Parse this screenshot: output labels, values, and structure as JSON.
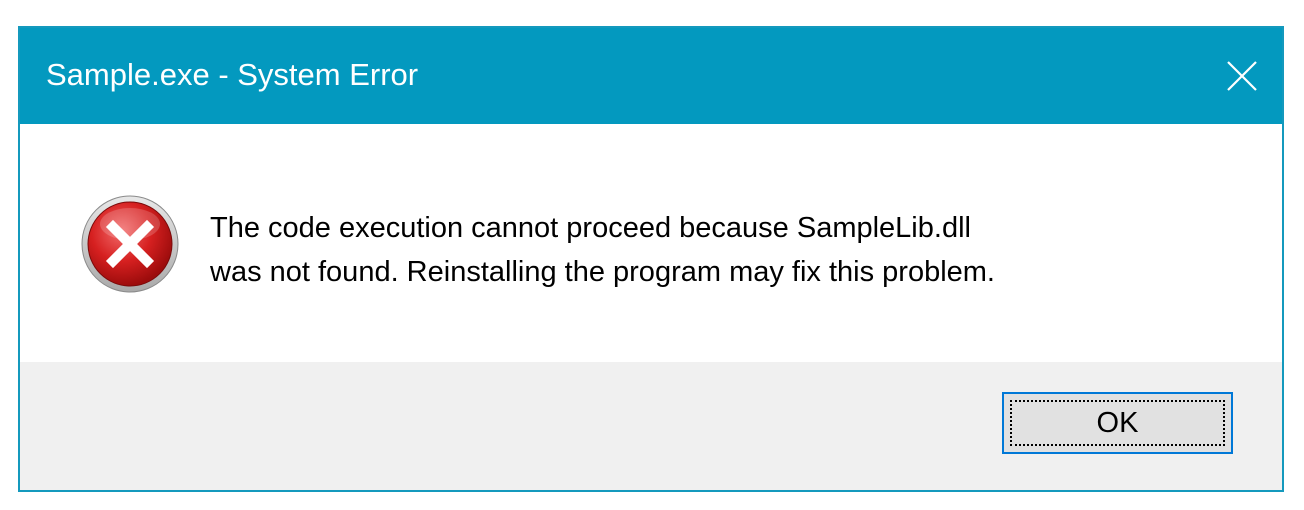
{
  "window": {
    "title": "Sample.exe - System Error",
    "titlebar_color": "#0399bf",
    "border_color": "#1499bd",
    "close_icon": "close-icon"
  },
  "message": {
    "icon": "error-icon",
    "line1": "The code execution cannot proceed because SampleLib.dll",
    "line2": "was not found. Reinstalling the program may fix this problem."
  },
  "footer": {
    "ok_label": "OK",
    "background": "#f0f0f0"
  }
}
